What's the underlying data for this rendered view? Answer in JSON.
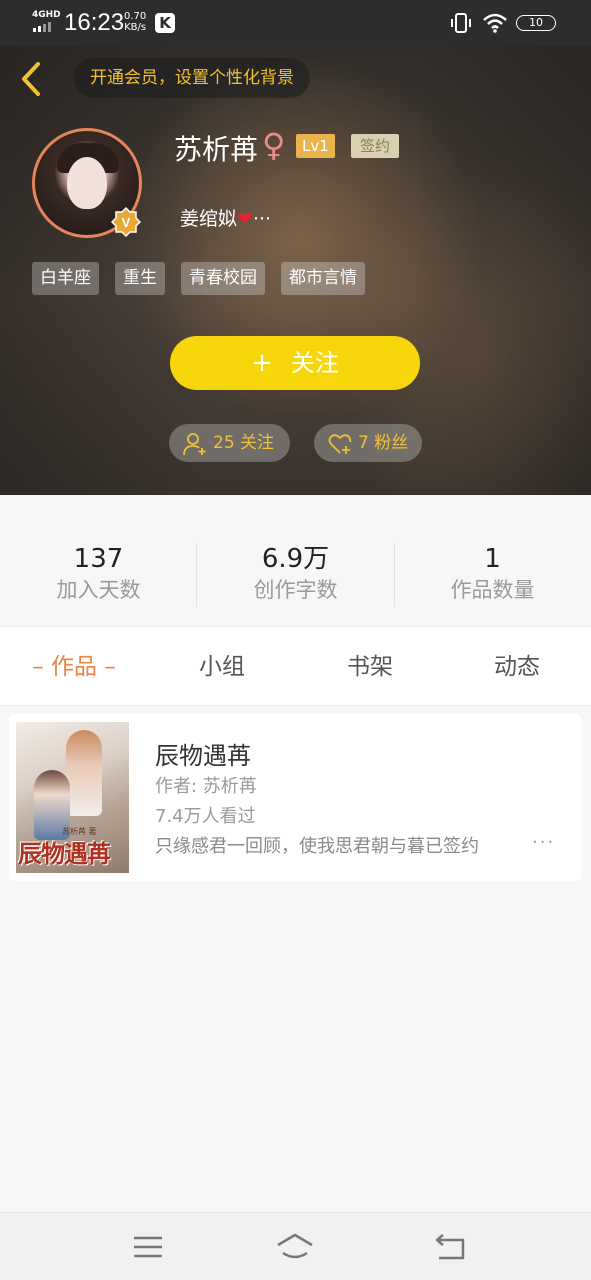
{
  "status_bar": {
    "network": "4GHD",
    "time": "16:23",
    "speed_value": "0.70",
    "speed_unit": "KB/s",
    "app_badge": "K",
    "battery": "10"
  },
  "header": {
    "vip_banner": "开通会员，设置个性化背景"
  },
  "profile": {
    "name": "苏析苒",
    "gender_symbol": "♀",
    "level": "Lv1",
    "signed_badge": "签约",
    "verified_badge": "V",
    "bio_text": "姜绾姒",
    "bio_heart": "❤",
    "bio_ellipsis": "···",
    "tags": [
      "白羊座",
      "重生",
      "青春校园",
      "都市言情"
    ],
    "follow_button": "关注",
    "follow_plus": "+",
    "following_count_label": "25 关注",
    "fans_count_label": "7 粉丝"
  },
  "stats": [
    {
      "value": "137",
      "label": "加入天数"
    },
    {
      "value": "6.9万",
      "label": "创作字数"
    },
    {
      "value": "1",
      "label": "作品数量"
    }
  ],
  "tabs": [
    {
      "label": "– 作品 –",
      "active": true
    },
    {
      "label": "小组",
      "active": false
    },
    {
      "label": "书架",
      "active": false
    },
    {
      "label": "动态",
      "active": false
    }
  ],
  "works": [
    {
      "title": "辰物遇苒",
      "author": "作者: 苏析苒",
      "views": "7.4万人看过",
      "description": "只缘感君一回顾，使我思君朝与暮已签约",
      "more": "···",
      "cover_title": "辰物遇苒",
      "cover_author": "苏析苒 著"
    }
  ],
  "colors": {
    "accent_orange": "#ec8445",
    "follow_yellow": "#f8d60c",
    "vip_gold": "#f2c233",
    "level_badge": "#e9b44c"
  }
}
